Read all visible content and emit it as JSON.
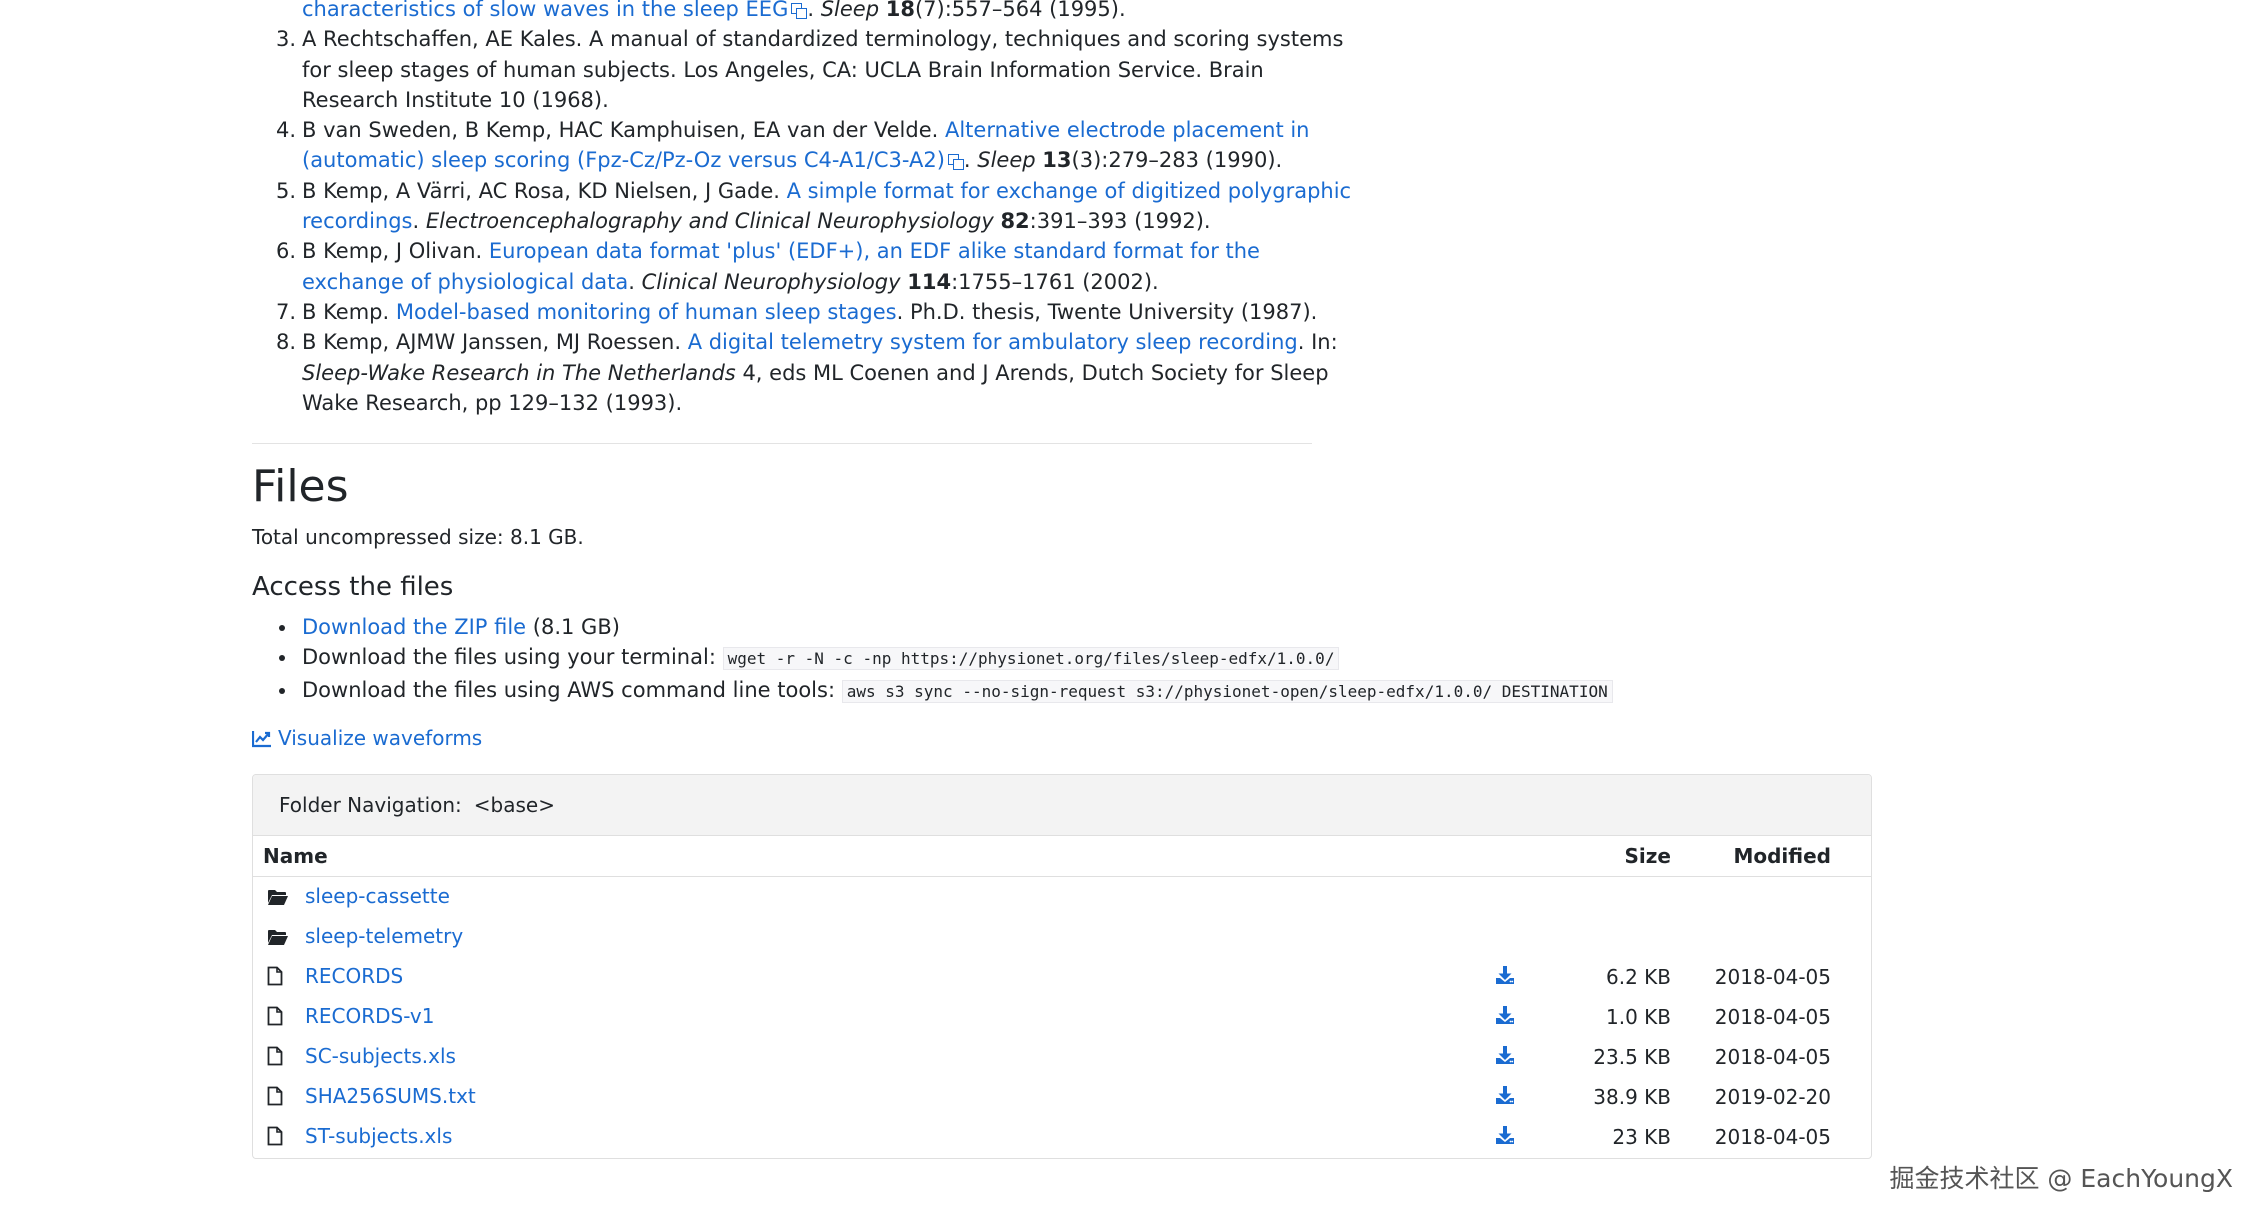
{
  "references": [
    {
      "num": "",
      "parts": [
        {
          "t": "link",
          "v": "characteristics of slow waves in the sleep EEG",
          "ext": true
        },
        {
          "t": "text",
          "v": ". "
        },
        {
          "t": "em",
          "v": "Sleep"
        },
        {
          "t": "text",
          "v": " "
        },
        {
          "t": "strong",
          "v": "18"
        },
        {
          "t": "text",
          "v": "(7):557–564 (1995)."
        }
      ]
    },
    {
      "num": "3.",
      "parts": [
        {
          "t": "text",
          "v": "A Rechtschaffen, AE Kales. A manual of standardized terminology, techniques and scoring systems for sleep stages of human subjects. Los Angeles, CA: UCLA Brain Information Service. Brain Research Institute 10 (1968)."
        }
      ]
    },
    {
      "num": "4.",
      "parts": [
        {
          "t": "text",
          "v": "B van Sweden, B Kemp, HAC Kamphuisen, EA van der Velde. "
        },
        {
          "t": "link",
          "v": "Alternative electrode placement in (automatic) sleep scoring (Fpz-Cz/Pz-Oz versus C4-A1/C3-A2)",
          "ext": true
        },
        {
          "t": "text",
          "v": ". "
        },
        {
          "t": "em",
          "v": "Sleep"
        },
        {
          "t": "text",
          "v": " "
        },
        {
          "t": "strong",
          "v": "13"
        },
        {
          "t": "text",
          "v": "(3):279–283 (1990)."
        }
      ]
    },
    {
      "num": "5.",
      "parts": [
        {
          "t": "text",
          "v": "B Kemp, A Värri, AC Rosa, KD Nielsen, J Gade. "
        },
        {
          "t": "link",
          "v": "A simple format for exchange of digitized polygraphic recordings"
        },
        {
          "t": "text",
          "v": ". "
        },
        {
          "t": "em",
          "v": "Electroencephalography and Clinical Neurophysiology"
        },
        {
          "t": "text",
          "v": " "
        },
        {
          "t": "strong",
          "v": "82"
        },
        {
          "t": "text",
          "v": ":391–393 (1992)."
        }
      ]
    },
    {
      "num": "6.",
      "parts": [
        {
          "t": "text",
          "v": "B Kemp, J Olivan. "
        },
        {
          "t": "link",
          "v": "European data format 'plus' (EDF+), an EDF alike standard format for the exchange of physiological data"
        },
        {
          "t": "text",
          "v": ". "
        },
        {
          "t": "em",
          "v": "Clinical Neurophysiology"
        },
        {
          "t": "text",
          "v": " "
        },
        {
          "t": "strong",
          "v": "114"
        },
        {
          "t": "text",
          "v": ":1755–1761 (2002)."
        }
      ]
    },
    {
      "num": "7.",
      "parts": [
        {
          "t": "text",
          "v": "B Kemp. "
        },
        {
          "t": "link",
          "v": "Model-based monitoring of human sleep stages"
        },
        {
          "t": "text",
          "v": ". Ph.D. thesis, Twente University (1987)."
        }
      ]
    },
    {
      "num": "8.",
      "parts": [
        {
          "t": "text",
          "v": "B Kemp, AJMW Janssen, MJ Roessen. "
        },
        {
          "t": "link",
          "v": "A digital telemetry system for ambulatory sleep recording"
        },
        {
          "t": "text",
          "v": ". In: "
        },
        {
          "t": "em",
          "v": "Sleep-Wake Research in The Netherlands"
        },
        {
          "t": "text",
          "v": " 4, eds ML Coenen and J Arends, Dutch Society for Sleep Wake Research, pp 129–132 (1993)."
        }
      ]
    }
  ],
  "files": {
    "title": "Files",
    "total_size": "Total uncompressed size: 8.1 GB.",
    "access_title": "Access the files",
    "zip_link": "Download the ZIP file",
    "zip_size": " (8.1 GB)",
    "terminal_label": "Download the files using your terminal: ",
    "terminal_cmd": "wget -r -N -c -np https://physionet.org/files/sleep-edfx/1.0.0/",
    "aws_label": "Download the files using AWS command line tools: ",
    "aws_cmd": "aws s3 sync --no-sign-request s3://physionet-open/sleep-edfx/1.0.0/ DESTINATION",
    "visualize": "Visualize waveforms"
  },
  "browser": {
    "nav_label": "Folder Navigation:",
    "nav_path": "<base>",
    "headers": {
      "name": "Name",
      "size": "Size",
      "modified": "Modified"
    },
    "rows": [
      {
        "type": "folder",
        "name": "sleep-cassette",
        "size": "",
        "modified": ""
      },
      {
        "type": "folder",
        "name": "sleep-telemetry",
        "size": "",
        "modified": ""
      },
      {
        "type": "file",
        "name": "RECORDS",
        "size": "6.2 KB",
        "modified": "2018-04-05"
      },
      {
        "type": "file",
        "name": "RECORDS-v1",
        "size": "1.0 KB",
        "modified": "2018-04-05"
      },
      {
        "type": "file",
        "name": "SC-subjects.xls",
        "size": "23.5 KB",
        "modified": "2018-04-05"
      },
      {
        "type": "file",
        "name": "SHA256SUMS.txt",
        "size": "38.9 KB",
        "modified": "2019-02-20"
      },
      {
        "type": "file",
        "name": "ST-subjects.xls",
        "size": "23 KB",
        "modified": "2018-04-05"
      }
    ]
  },
  "watermark": "掘金技术社区 @ EachYoungX",
  "colors": {
    "link": "#1a6bd1",
    "text": "#212529",
    "panel_head": "#f3f3f3"
  }
}
